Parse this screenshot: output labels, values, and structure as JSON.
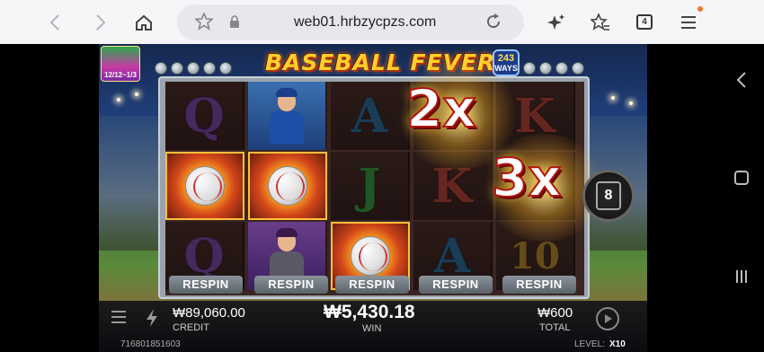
{
  "browser": {
    "url": "web01.hrbzycpzs.com",
    "tab_count": "4"
  },
  "game": {
    "title": "BASEBALL FEVER",
    "ways_top": "243",
    "ways_label": "WAYS",
    "promo_text": "12/12~1/3",
    "multipliers": [
      "2x",
      "3x"
    ],
    "remaining_counter": "8",
    "reels": [
      [
        "Q",
        "ball",
        "Q"
      ],
      [
        "player",
        "ball",
        "catcher"
      ],
      [
        "A",
        "J",
        "ball"
      ],
      [
        "2x-area",
        "K",
        "A"
      ],
      [
        "K",
        "3x-area",
        "10"
      ]
    ],
    "respin_labels": [
      "RESPIN",
      "RESPIN",
      "RESPIN",
      "RESPIN",
      "RESPIN"
    ]
  },
  "bottom": {
    "credit_value": "₩89,060.00",
    "credit_label": "CREDIT",
    "win_value": "₩5,430.18",
    "win_label": "WIN",
    "total_value": "₩600",
    "total_label": "TOTAL",
    "round_id": "716801851603",
    "level_label": "LEVEL:",
    "level_value": "X10"
  },
  "icons": [
    "back-icon",
    "forward-icon",
    "home-icon",
    "star-icon",
    "lock-icon",
    "reload-icon",
    "sparkle-icon",
    "bookmarks-icon",
    "tabs-icon",
    "menu-icon",
    "nav-back-icon",
    "nav-home-icon",
    "nav-recents-icon",
    "hamburger-icon",
    "bolt-icon",
    "spin-icon"
  ],
  "colors": {
    "title": "#ffd02a",
    "multiplier_stroke": "#b0160e",
    "notification": "#f5742a"
  }
}
